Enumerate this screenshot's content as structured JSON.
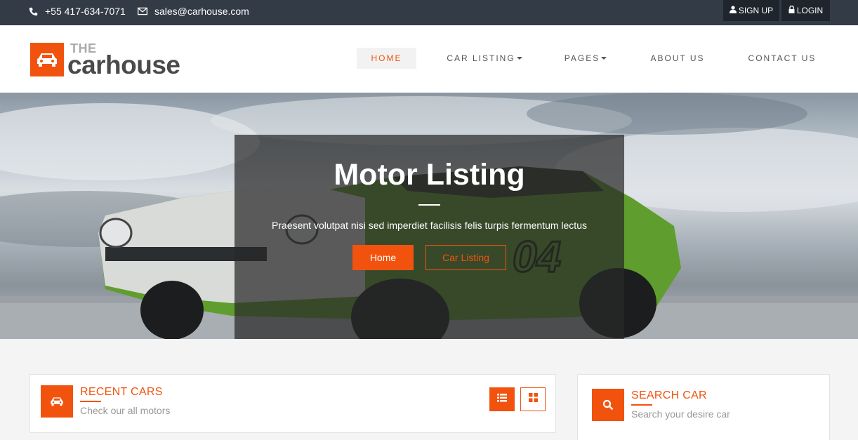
{
  "topbar": {
    "phone": "+55 417-634-7071",
    "email": "sales@carhouse.com",
    "signup": "SIGN UP",
    "login": "LOGIN"
  },
  "logo": {
    "the": "THE",
    "name": "carhouse"
  },
  "nav": [
    {
      "label": "HOME"
    },
    {
      "label": "CAR LISTING"
    },
    {
      "label": "PAGES"
    },
    {
      "label": "ABOUT US"
    },
    {
      "label": "CONTACT US"
    }
  ],
  "hero": {
    "title": "Motor Listing",
    "subtitle": "Praesent volutpat nisi sed imperdiet facilisis felis turpis fermentum lectus",
    "btn_home": "Home",
    "btn_listing": "Car Listing"
  },
  "recent": {
    "title": "RECENT CARS",
    "subtitle": "Check our all motors"
  },
  "search": {
    "title": "SEARCH CAR",
    "subtitle": "Search your desire car"
  },
  "colors": {
    "accent": "#f1530f",
    "topbar": "#333b47",
    "auth_button": "#1f252d"
  },
  "icons": [
    "phone-icon",
    "envelope-icon",
    "user-icon",
    "lock-icon",
    "car-icon",
    "list-icon",
    "grid-icon",
    "search-icon"
  ]
}
